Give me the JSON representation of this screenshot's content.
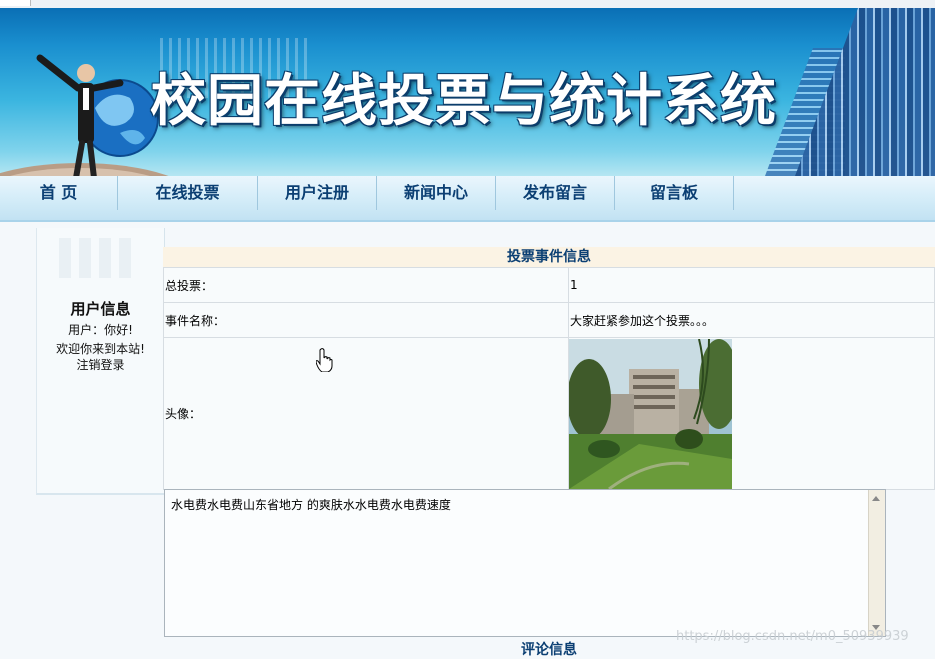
{
  "banner": {
    "title": "校园在线投票与统计系统"
  },
  "nav": {
    "items": [
      {
        "label": "首 页"
      },
      {
        "label": "在线投票"
      },
      {
        "label": "用户注册"
      },
      {
        "label": "新闻中心"
      },
      {
        "label": "发布留言"
      },
      {
        "label": "留言板"
      }
    ]
  },
  "sidebar": {
    "heading": "用户信息",
    "user_line": "用户：你好!",
    "welcome": "欢迎你来到本站!",
    "logout": "注销登录"
  },
  "vote_event": {
    "section_title": "投票事件信息",
    "rows": [
      {
        "label": "总投票：",
        "value": "1"
      },
      {
        "label": "事件名称：",
        "value": "大家赶紧参加这个投票。。。"
      },
      {
        "label": "头像：",
        "value": ""
      }
    ],
    "description": "水电费水电费山东省地方 的爽肤水水电费水电费速度"
  },
  "comments": {
    "section_title": "评论信息"
  },
  "watermark": "https://blog.csdn.net/m0_50939939"
}
